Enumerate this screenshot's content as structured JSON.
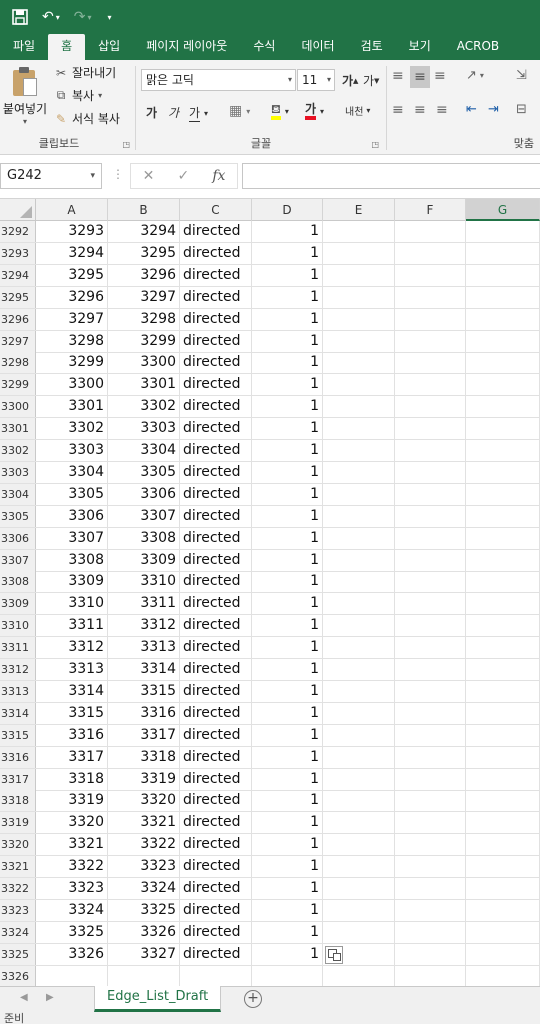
{
  "ribbon_tabs": [
    "파일",
    "홈",
    "삽입",
    "페이지 레이아웃",
    "수식",
    "데이터",
    "검토",
    "보기",
    "ACROB"
  ],
  "ribbon": {
    "paste_label": "붙여넣기",
    "cut_label": "잘라내기",
    "copy_label": "복사",
    "format_painter_label": "서식 복사",
    "clipboard_group": "클립보드",
    "font_name": "맑은 고딕",
    "font_size": "11",
    "grow_font": "가",
    "shrink_font": "가",
    "bold": "가",
    "italic": "가",
    "underline": "가",
    "font_color_btn": "가",
    "phonetic": "내천",
    "font_group": "글꼴",
    "align_group": "맞춤"
  },
  "formula_bar": {
    "name_box": "G242",
    "formula": ""
  },
  "columns": [
    "A",
    "B",
    "C",
    "D",
    "E",
    "F",
    "G"
  ],
  "selected_column": "G",
  "rows": [
    {
      "r": "3292",
      "a": "3293",
      "b": "3294",
      "c": "directed",
      "d": "1"
    },
    {
      "r": "3293",
      "a": "3294",
      "b": "3295",
      "c": "directed",
      "d": "1"
    },
    {
      "r": "3294",
      "a": "3295",
      "b": "3296",
      "c": "directed",
      "d": "1"
    },
    {
      "r": "3295",
      "a": "3296",
      "b": "3297",
      "c": "directed",
      "d": "1"
    },
    {
      "r": "3296",
      "a": "3297",
      "b": "3298",
      "c": "directed",
      "d": "1"
    },
    {
      "r": "3297",
      "a": "3298",
      "b": "3299",
      "c": "directed",
      "d": "1"
    },
    {
      "r": "3298",
      "a": "3299",
      "b": "3300",
      "c": "directed",
      "d": "1"
    },
    {
      "r": "3299",
      "a": "3300",
      "b": "3301",
      "c": "directed",
      "d": "1"
    },
    {
      "r": "3300",
      "a": "3301",
      "b": "3302",
      "c": "directed",
      "d": "1"
    },
    {
      "r": "3301",
      "a": "3302",
      "b": "3303",
      "c": "directed",
      "d": "1"
    },
    {
      "r": "3302",
      "a": "3303",
      "b": "3304",
      "c": "directed",
      "d": "1"
    },
    {
      "r": "3303",
      "a": "3304",
      "b": "3305",
      "c": "directed",
      "d": "1"
    },
    {
      "r": "3304",
      "a": "3305",
      "b": "3306",
      "c": "directed",
      "d": "1"
    },
    {
      "r": "3305",
      "a": "3306",
      "b": "3307",
      "c": "directed",
      "d": "1"
    },
    {
      "r": "3306",
      "a": "3307",
      "b": "3308",
      "c": "directed",
      "d": "1"
    },
    {
      "r": "3307",
      "a": "3308",
      "b": "3309",
      "c": "directed",
      "d": "1"
    },
    {
      "r": "3308",
      "a": "3309",
      "b": "3310",
      "c": "directed",
      "d": "1"
    },
    {
      "r": "3309",
      "a": "3310",
      "b": "3311",
      "c": "directed",
      "d": "1"
    },
    {
      "r": "3310",
      "a": "3311",
      "b": "3312",
      "c": "directed",
      "d": "1"
    },
    {
      "r": "3311",
      "a": "3312",
      "b": "3313",
      "c": "directed",
      "d": "1"
    },
    {
      "r": "3312",
      "a": "3313",
      "b": "3314",
      "c": "directed",
      "d": "1"
    },
    {
      "r": "3313",
      "a": "3314",
      "b": "3315",
      "c": "directed",
      "d": "1"
    },
    {
      "r": "3314",
      "a": "3315",
      "b": "3316",
      "c": "directed",
      "d": "1"
    },
    {
      "r": "3315",
      "a": "3316",
      "b": "3317",
      "c": "directed",
      "d": "1"
    },
    {
      "r": "3316",
      "a": "3317",
      "b": "3318",
      "c": "directed",
      "d": "1"
    },
    {
      "r": "3317",
      "a": "3318",
      "b": "3319",
      "c": "directed",
      "d": "1"
    },
    {
      "r": "3318",
      "a": "3319",
      "b": "3320",
      "c": "directed",
      "d": "1"
    },
    {
      "r": "3319",
      "a": "3320",
      "b": "3321",
      "c": "directed",
      "d": "1"
    },
    {
      "r": "3320",
      "a": "3321",
      "b": "3322",
      "c": "directed",
      "d": "1"
    },
    {
      "r": "3321",
      "a": "3322",
      "b": "3323",
      "c": "directed",
      "d": "1"
    },
    {
      "r": "3322",
      "a": "3323",
      "b": "3324",
      "c": "directed",
      "d": "1"
    },
    {
      "r": "3323",
      "a": "3324",
      "b": "3325",
      "c": "directed",
      "d": "1"
    },
    {
      "r": "3324",
      "a": "3325",
      "b": "3326",
      "c": "directed",
      "d": "1"
    },
    {
      "r": "3325",
      "a": "3326",
      "b": "3327",
      "c": "directed",
      "d": "1"
    },
    {
      "r": "3326",
      "a": "",
      "b": "",
      "c": "",
      "d": ""
    }
  ],
  "sheet_tabs": [
    "Edge_List_Draft"
  ],
  "status": "준비",
  "colors": {
    "excel_green": "#217346",
    "ribbon_bg": "#f3f3f3",
    "header_bg": "#f0f0f0"
  }
}
